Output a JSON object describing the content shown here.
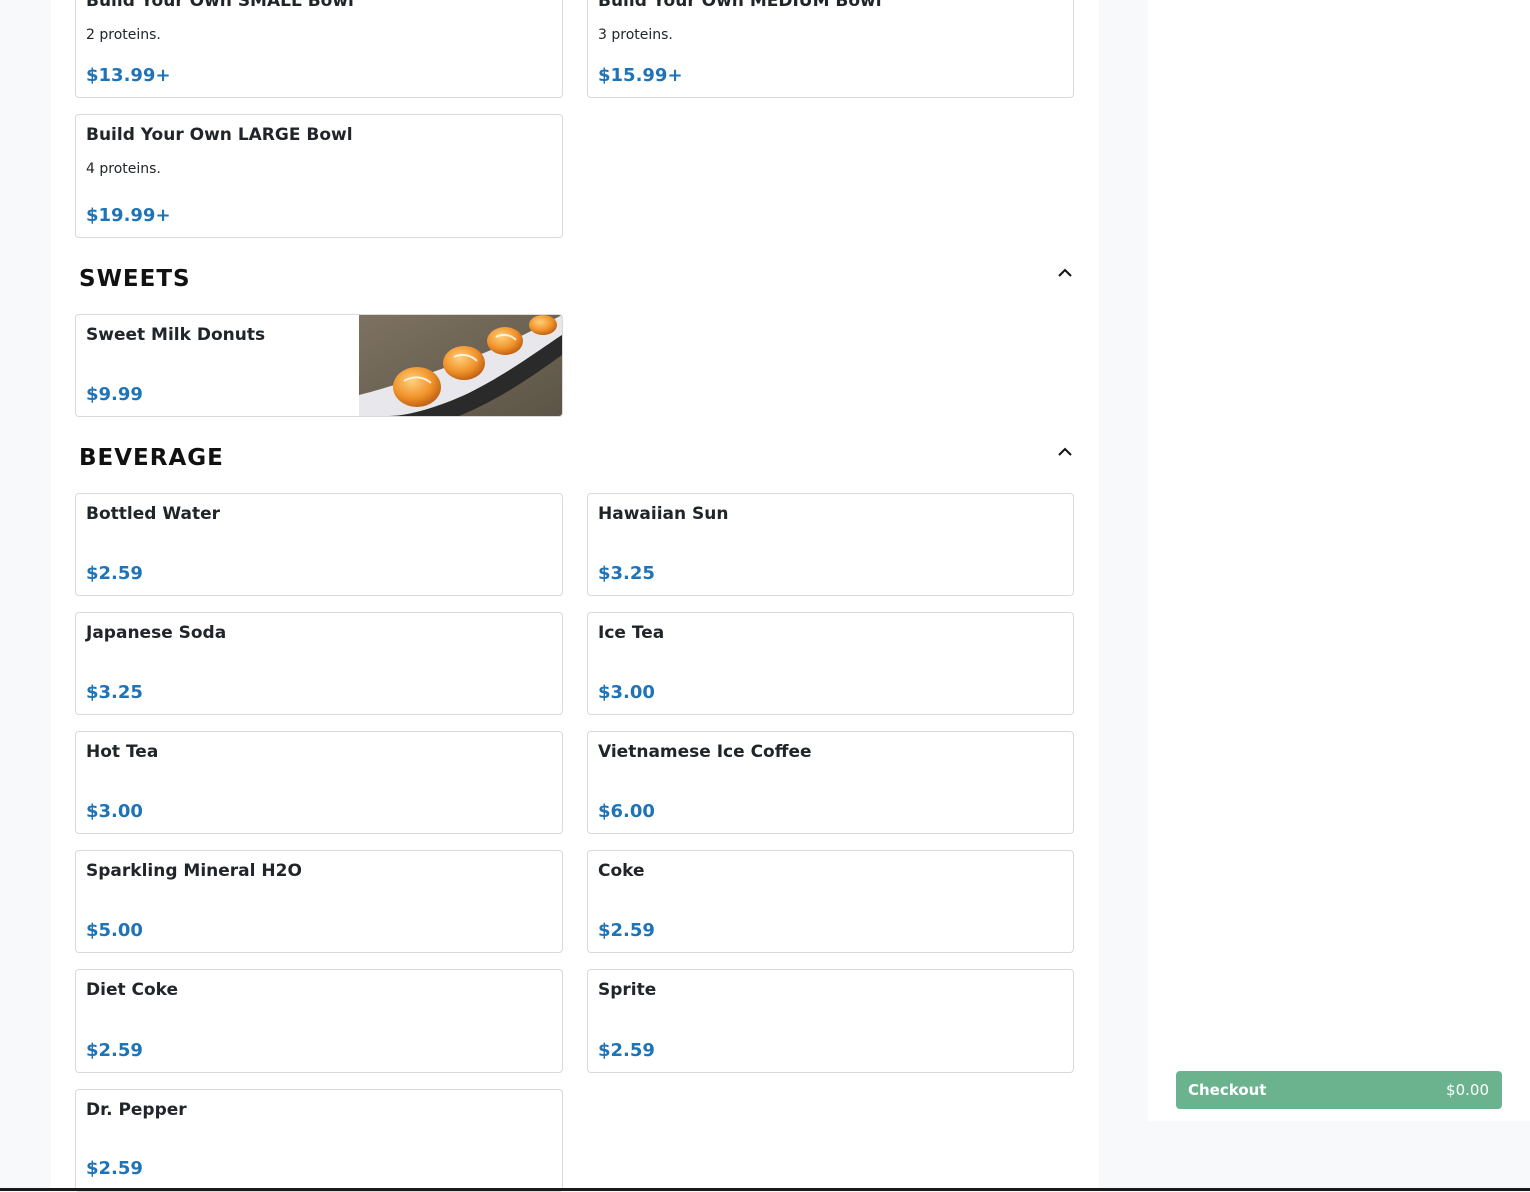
{
  "bowls": {
    "items": [
      {
        "name": "Build Your Own SMALL Bowl",
        "desc": "2 proteins.",
        "price": "$13.99+"
      },
      {
        "name": "Build Your Own MEDIUM Bowl",
        "desc": "3 proteins.",
        "price": "$15.99+"
      },
      {
        "name": "Build Your Own LARGE Bowl",
        "desc": "4 proteins.",
        "price": "$19.99+"
      }
    ]
  },
  "sweets": {
    "title": "SWEETS",
    "items": [
      {
        "name": "Sweet Milk Donuts",
        "price": "$9.99"
      }
    ]
  },
  "beverage": {
    "title": "BEVERAGE",
    "items": [
      {
        "name": "Bottled Water",
        "price": "$2.59"
      },
      {
        "name": "Hawaiian Sun",
        "price": "$3.25"
      },
      {
        "name": "Japanese Soda",
        "price": "$3.25"
      },
      {
        "name": "Ice Tea",
        "price": "$3.00"
      },
      {
        "name": "Hot Tea",
        "price": "$3.00"
      },
      {
        "name": "Vietnamese Ice Coffee",
        "price": "$6.00"
      },
      {
        "name": "Sparkling Mineral H2O",
        "price": "$5.00"
      },
      {
        "name": "Coke",
        "price": "$2.59"
      },
      {
        "name": "Diet Coke",
        "price": "$2.59"
      },
      {
        "name": "Sprite",
        "price": "$2.59"
      },
      {
        "name": "Dr. Pepper",
        "price": "$2.59"
      }
    ]
  },
  "checkout": {
    "label": "Checkout",
    "amount": "$0.00"
  },
  "colors": {
    "price": "#1f73b7",
    "checkout": "#6ab38e"
  },
  "icons": {
    "collapse": "chevron-up-icon"
  }
}
